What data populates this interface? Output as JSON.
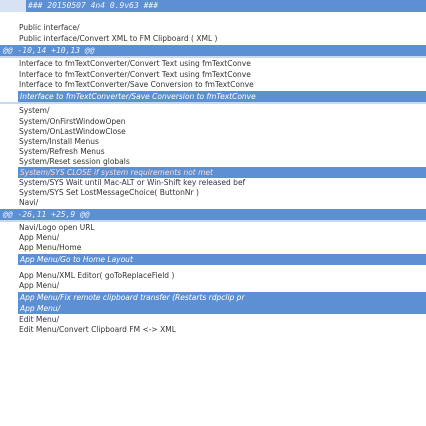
{
  "header": {
    "title": "### 20150507 4n4 0.9v63 ###"
  },
  "lines": [
    "Public interface/",
    "Public interface/Convert XML to FM Clipboard ( XML )",
    "Interface to fmTextConverter/Convert Text using fmTextConve",
    "Interface to fmTextConverter/Convert Text using fmTextConve",
    "Interface to fmTextConverter/Save Conversion to fmTextConve",
    "System/",
    "System/OnFirstWindowOpen",
    "System/OnLastWindowClose",
    "System/Install Menus",
    "System/Refresh Menus",
    "System/Reset session globals",
    "System/SYS Wait until Mac-ALT or Win-Shift key released bef",
    "System/SYS Set LostMessageChoice( ButtonNr )",
    "Navi/",
    "Navi/Logo open URL",
    "App Menu/",
    "App Menu/Home",
    "App Menu/XML Editor( goToReplaceField )",
    "App Menu/",
    "Edit Menu/",
    "Edit Menu/Convert Clipboard FM <-> XML"
  ],
  "bars": [
    "@@ -10,14 +10,13 @@",
    "Interface to fmTextConverter/Save Conversion to fmTextConve",
    "System/SYS CLOSE if system requirements not met",
    "@@ -26,11 +25,9 @@",
    "App Menu/Go to Home Layout",
    "App Menu/Fix remote clipboard transfer (Restarts rdpclip pr",
    "App Menu/"
  ]
}
